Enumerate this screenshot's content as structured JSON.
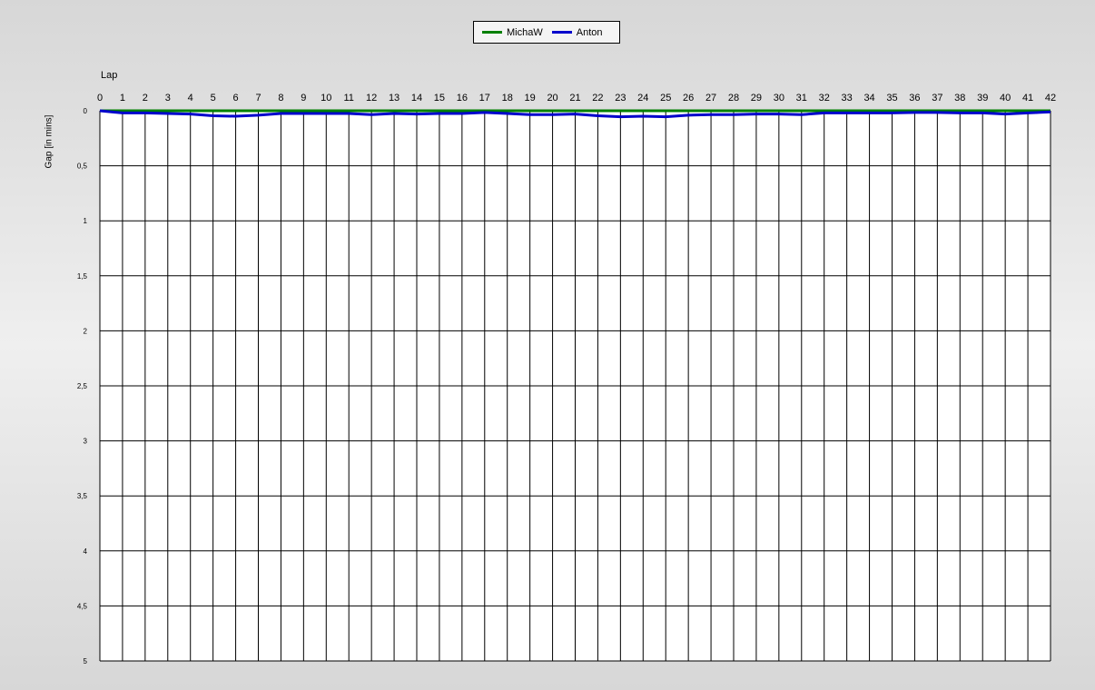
{
  "chart_data": {
    "type": "line",
    "title": "",
    "xlabel": "Lap",
    "ylabel": "Gap [in mins]",
    "x": [
      0,
      1,
      2,
      3,
      4,
      5,
      6,
      7,
      8,
      9,
      10,
      11,
      12,
      13,
      14,
      15,
      16,
      17,
      18,
      19,
      20,
      21,
      22,
      23,
      24,
      25,
      26,
      27,
      28,
      29,
      30,
      31,
      32,
      33,
      34,
      35,
      36,
      37,
      38,
      39,
      40,
      41,
      42
    ],
    "x_ticks": [
      "0",
      "1",
      "2",
      "3",
      "4",
      "5",
      "6",
      "7",
      "8",
      "9",
      "10",
      "11",
      "12",
      "13",
      "14",
      "15",
      "16",
      "17",
      "18",
      "19",
      "20",
      "21",
      "22",
      "23",
      "24",
      "25",
      "26",
      "27",
      "28",
      "29",
      "30",
      "31",
      "32",
      "33",
      "34",
      "35",
      "36",
      "37",
      "38",
      "39",
      "40",
      "41",
      "42"
    ],
    "y_ticks": [
      "0",
      "0,5",
      "1",
      "1,5",
      "2",
      "2,5",
      "3",
      "3,5",
      "4",
      "4,5",
      "5"
    ],
    "xlim": [
      0,
      42
    ],
    "ylim": [
      0,
      5
    ],
    "y_inverted": true,
    "x_axis_position": "top",
    "grid": true,
    "legend_position": "top-center",
    "series": [
      {
        "name": "MichaW",
        "color": "#008000",
        "values": [
          0,
          0,
          0,
          0,
          0,
          0,
          0,
          0,
          0,
          0,
          0,
          0,
          0,
          0,
          0,
          0,
          0,
          0,
          0,
          0,
          0,
          0,
          0,
          0,
          0,
          0,
          0,
          0,
          0,
          0,
          0,
          0,
          0,
          0,
          0,
          0,
          0,
          0,
          0,
          0,
          0,
          0,
          0
        ]
      },
      {
        "name": "Anton",
        "color": "#0000cc",
        "values": [
          0,
          0.02,
          0.02,
          0.025,
          0.03,
          0.045,
          0.05,
          0.04,
          0.025,
          0.025,
          0.025,
          0.025,
          0.035,
          0.025,
          0.03,
          0.025,
          0.025,
          0.015,
          0.025,
          0.035,
          0.035,
          0.03,
          0.045,
          0.055,
          0.05,
          0.055,
          0.04,
          0.035,
          0.035,
          0.03,
          0.03,
          0.035,
          0.02,
          0.02,
          0.02,
          0.02,
          0.015,
          0.015,
          0.02,
          0.02,
          0.03,
          0.02,
          0.01
        ]
      }
    ]
  }
}
